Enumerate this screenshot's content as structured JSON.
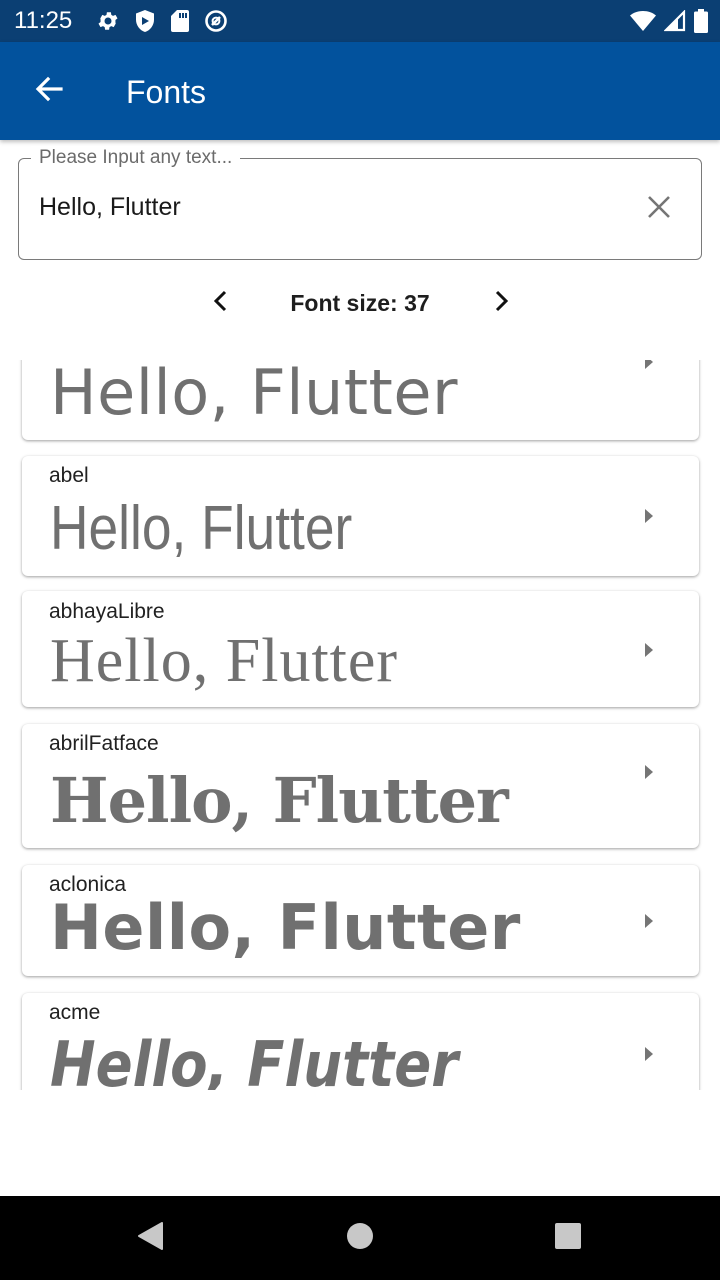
{
  "status_bar": {
    "time": "11:25",
    "left_icons": [
      "settings-icon",
      "shield-icon",
      "sd-card-icon",
      "do-not-disturb-icon"
    ],
    "right_icons": [
      "wifi-icon",
      "signal-icon",
      "battery-icon"
    ]
  },
  "app_bar": {
    "title": "Fonts",
    "back_icon": "arrow-back-icon"
  },
  "text_field": {
    "label": "Please Input any text...",
    "value": "Hello, Flutter",
    "clear_icon": "close-icon"
  },
  "font_size": {
    "label": "Font size: 37",
    "prev_icon": "chevron-left-icon",
    "next_icon": "chevron-right-icon"
  },
  "fonts": [
    {
      "name": "",
      "sample": "Hello, Flutter"
    },
    {
      "name": "abel",
      "sample": "Hello, Flutter"
    },
    {
      "name": "abhayaLibre",
      "sample": "Hello, Flutter"
    },
    {
      "name": "abrilFatface",
      "sample": "Hello, Flutter"
    },
    {
      "name": "aclonica",
      "sample": "Hello, Flutter"
    },
    {
      "name": "acme",
      "sample": "Hello, Flutter"
    }
  ],
  "nav_bar": {
    "icons": [
      "back-triangle-icon",
      "home-circle-icon",
      "recents-square-icon"
    ]
  },
  "colors": {
    "status_bar": "#0b3f73",
    "app_bar": "#02529d",
    "sample_text": "#707070"
  }
}
